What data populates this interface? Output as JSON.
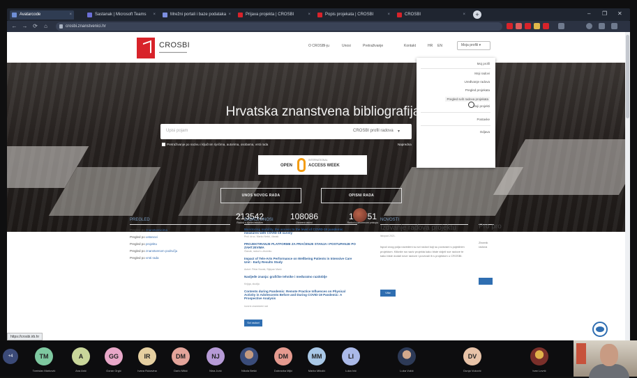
{
  "browser": {
    "tabs": [
      {
        "label": "Avatarcode",
        "active": true
      },
      {
        "label": "Sastanak | Microsoft Teams"
      },
      {
        "label": "Mrežni portali i baze podataka"
      },
      {
        "label": "Prijava projekta | CROSBI"
      },
      {
        "label": "Popis projekata | CROSBI"
      },
      {
        "label": "CROSBI"
      }
    ],
    "address": "crosbi.znanstvenici.hr",
    "window_controls": [
      "–",
      "❐",
      "✕"
    ]
  },
  "site": {
    "logo_text": "CROSBI",
    "nav": [
      "O CROSBI-ju",
      "Unosi",
      "Pretraživanje",
      "Kontakt",
      "HR",
      "EN"
    ],
    "user_button": "Moja profili"
  },
  "hero": {
    "title": "Hrvatska znanstvena bibliografija",
    "search_placeholder": "Upisi pojam",
    "search_scope": "CROSBI profil radova",
    "hint": "Pretraživanje po nazivu i ključnim riječima, autorima, osobama, vrsti rada",
    "advanced_link": "Napredna",
    "oa": {
      "week": "INTERNATIONAL",
      "open": "OPEN",
      "access": "ACCESS WEEK"
    },
    "buttons": [
      "UNOS NOVOG RADA",
      "OPISNI RADA"
    ],
    "stats": [
      {
        "value": "213542",
        "label": "Radovi s cijelim tekstom"
      },
      {
        "value": "108086",
        "label": "Otvoreni radovi"
      },
      {
        "value": "100751",
        "label": "Radovi u otvorenom pristupu"
      }
    ]
  },
  "dropdown": {
    "items": [
      "Moj profil",
      "Moji radovi",
      "Uređivanje radova",
      "Pregled projekata",
      "Pregled svih radova projekata",
      "Moji projekti",
      "Postavke",
      "Odjava"
    ]
  },
  "browse": {
    "title": "PREGLED",
    "items": [
      {
        "prefix": "Pregled po ",
        "link": "znanstvenicima"
      },
      {
        "prefix": "Pregled po ",
        "link": "ustanovi"
      },
      {
        "prefix": "Pregled po ",
        "link": "projektu"
      },
      {
        "prefix": "Pregled po ",
        "link": "znanstvenom području"
      },
      {
        "prefix": "Pregled po ",
        "link": "vrsti rada"
      }
    ]
  },
  "latest": {
    "title": "ZADNJI UNOSI",
    "items": [
      {
        "title": "Monitoring mobility, the access to the level of COVID-19 pandemic measures with COVID-19 survey",
        "meta": "Prof. dr.sc. Marko Nekić, članak"
      },
      {
        "title": "PROJEKTIRANJE PLATFORME ZA PRAĆENJE STANJA I POSTUPANJE PO ZAHTJEVIMA",
        "meta": "Članak, radovi u zborniku"
      },
      {
        "title": "Impact of Tele-Arts Performance on Wellbeing Patients in Intensive Care Unit - Early Results Study",
        "meta": "Autori: Petar Novak, Stjepan Marić"
      },
      {
        "title": "Nasljeđe znanja: grafičke tehnike i međuratno razdoblje",
        "meta": "Knjiga, studija"
      },
      {
        "title": "Contents during Pandemic: Remote Practice Influences on Physical Activity in Adolescents Before and During COVID-19 Pandemic: A Prospective Analysis",
        "meta": "Izvorni znanstveni rad"
      }
    ],
    "more_button": "Svi radovi"
  },
  "news": {
    "title": "NOVOSTI",
    "heading": "Izdvanje radova projektu",
    "date": "listopad 2021.",
    "text": "Ispod ovog polja navedeni su svi radovi koji su povezani s pojedinim projektom. Kliknite na naziv projekta kako biste vidjeli sve radove te kako biste dodali nove radove i povezali ih s projektom u CROSBI.",
    "button": "Više",
    "side_title": "Pro pro",
    "side_text": "Zbornik radova"
  },
  "status_url": "https://crosbi.irb.hr",
  "participants": [
    {
      "initials": "+4",
      "name": ""
    },
    {
      "initials": "TM",
      "name": "Tomislav Marković",
      "color": "#7ec8a0"
    },
    {
      "initials": "A",
      "name": "Ana Anić",
      "color": "#c9d69a"
    },
    {
      "initials": "GG",
      "name": "Goran Grgić",
      "color": "#e8a7c8"
    },
    {
      "initials": "IR",
      "name": "Ivana Rukavina",
      "color": "#e5cfa0"
    },
    {
      "initials": "DM",
      "name": "Dario Mikić",
      "color": "#e3a49a"
    },
    {
      "initials": "NJ",
      "name": "Nina Jurić",
      "color": "#b69ad6"
    },
    {
      "initials": "",
      "name": "Nikola Bešić",
      "photo": true
    },
    {
      "initials": "DM",
      "name": "Dubravka Mijić",
      "color": "#e59a8f"
    },
    {
      "initials": "MM",
      "name": "Marko Mikulić",
      "color": "#a8c7e6"
    },
    {
      "initials": "LI",
      "name": "Luka Ivić",
      "color": "#aab9e8"
    },
    {
      "initials": "",
      "name": "Luka Vukić",
      "photo": true
    },
    {
      "initials": "DV",
      "name": "Dunja Vuković",
      "color": "#e8c3a8"
    },
    {
      "initials": "",
      "name": "Ivan Lovrić",
      "photo": true
    }
  ]
}
